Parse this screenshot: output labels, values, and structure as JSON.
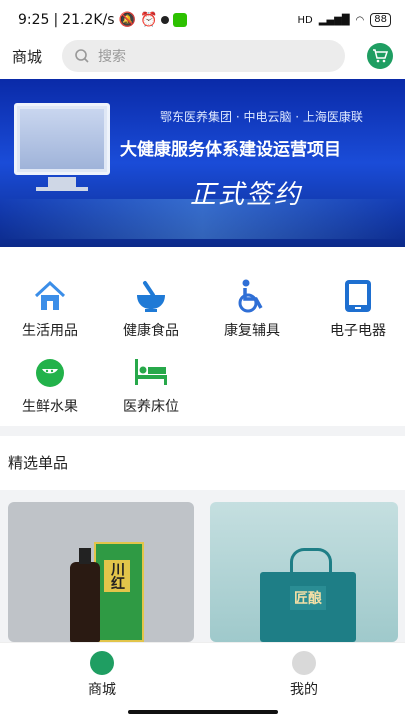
{
  "status": {
    "time": "9:25",
    "speed": "21.2K/s",
    "battery": "88",
    "network": "HD"
  },
  "header": {
    "title": "商城",
    "search_placeholder": "搜索"
  },
  "banner": {
    "subtitle": "鄂东医养集团 · 中电云脑 · 上海医康联",
    "title": "大健康服务体系建设运营项目",
    "slogan": "正式签约"
  },
  "categories": [
    {
      "label": "生活用品",
      "icon": "house-icon",
      "color": "#3b8ee8"
    },
    {
      "label": "健康食品",
      "icon": "mortar-bowl-icon",
      "color": "#1f7ad6"
    },
    {
      "label": "康复辅具",
      "icon": "wheelchair-icon",
      "color": "#2f6fd6"
    },
    {
      "label": "电子电器",
      "icon": "tablet-icon",
      "color": "#1e6fd0"
    },
    {
      "label": "生鲜水果",
      "icon": "melon-icon",
      "color": "#22b24a"
    },
    {
      "label": "医养床位",
      "icon": "bed-icon",
      "color": "#27a84a"
    }
  ],
  "section": {
    "title": "精选单品"
  },
  "products": [
    {
      "label": "川红"
    },
    {
      "label": "匠酿"
    }
  ],
  "tabs": [
    {
      "label": "商城"
    },
    {
      "label": "我的"
    }
  ],
  "colors": {
    "accent": "#1f9e62",
    "banner": "#1a4cd8"
  }
}
